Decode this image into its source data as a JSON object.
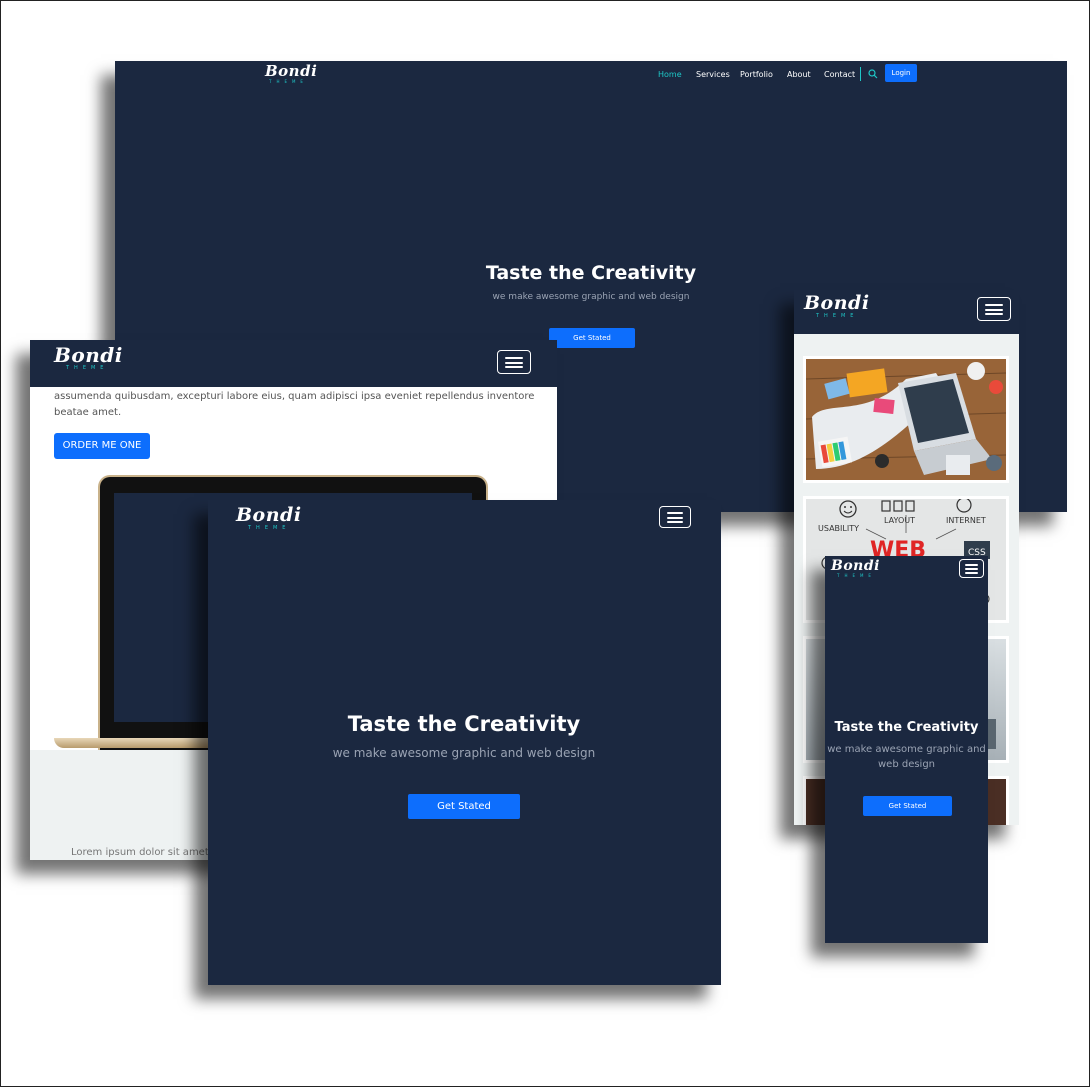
{
  "brand": {
    "name": "Bondi",
    "tagline": "THEME"
  },
  "nav": {
    "items": [
      "Home",
      "Services",
      "Portfolio",
      "About",
      "Contact"
    ],
    "login": "Login"
  },
  "hero": {
    "title": "Taste the Creativity",
    "subtitle": "we make awesome graphic and web design",
    "cta": "Get Stated"
  },
  "about": {
    "text_line1": "assumenda quibusdam, excepturi labore eius, quam adipisci ipsa eveniet repellendus inventore",
    "text_line2": "beatae amet.",
    "cta": "ORDER ME ONE",
    "footer_text": "Lorem ipsum dolor sit amet"
  },
  "portfolio": {
    "words": [
      "USABILITY",
      "LAYOUT",
      "INTERNET",
      "WEB",
      "CSS"
    ]
  },
  "colors": {
    "navy": "#1b2840",
    "accent": "#0d6efd",
    "teal": "#1ec7c7",
    "muted": "#9aa3b3"
  }
}
